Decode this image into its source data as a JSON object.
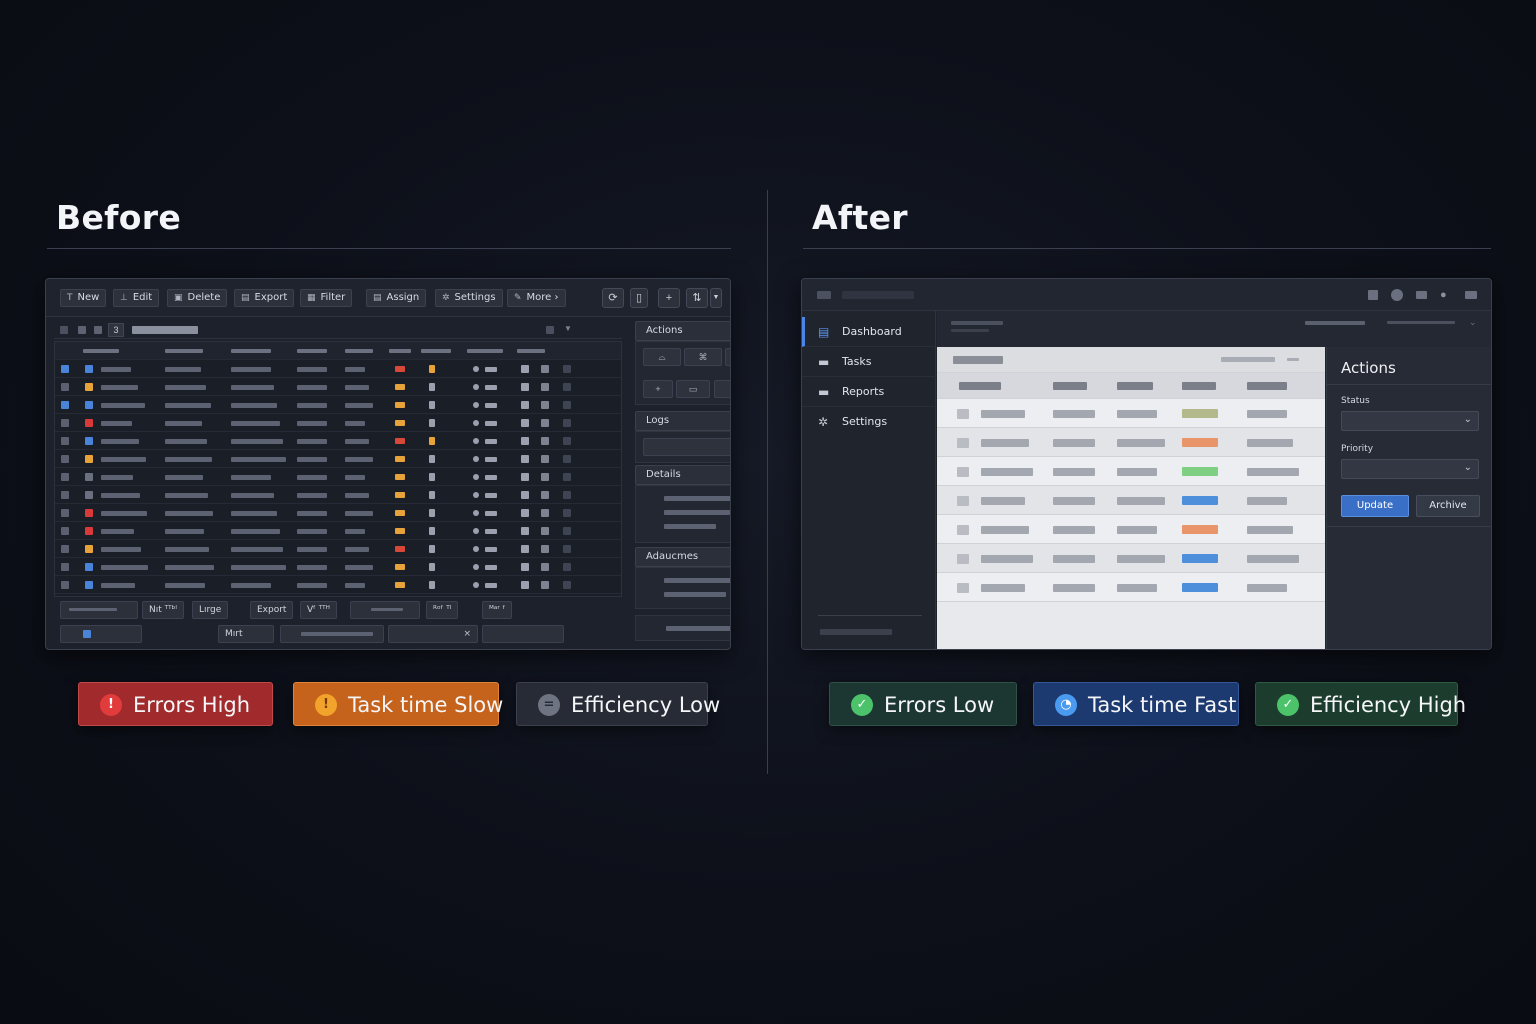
{
  "before": {
    "heading": "Before",
    "toolbar": {
      "buttons": [
        {
          "icon": "T",
          "label": "New"
        },
        {
          "icon": "⊥",
          "label": "Edit"
        },
        {
          "icon": "▣",
          "label": "Delete"
        },
        {
          "icon": "▤",
          "label": "Export"
        },
        {
          "icon": "▦",
          "label": "Filter"
        },
        {
          "icon": "▤",
          "label": "Assign"
        },
        {
          "icon": "✲",
          "label": "Settings"
        },
        {
          "icon": "✎",
          "label": "More ›"
        }
      ],
      "grid_count": "3"
    },
    "side_panels": {
      "actions": "Actions",
      "logs": "Logs",
      "details": "Details",
      "attachments": "Adaucmes"
    },
    "footer": {
      "row1": [
        "Nıt ᵀᵀᵇˡ",
        "Lırge",
        "Export",
        "ᐯᶠ ᵀᵀᴴ",
        "ᴿᵒᶠ ᵀᴵ",
        "ᴹᵃʳ ᶠ"
      ],
      "row2": [
        "Mırt"
      ]
    },
    "badges": [
      {
        "icon": "!",
        "label": "Errors High",
        "color": "#a52a2a"
      },
      {
        "icon": "!",
        "label": "Task time Slow",
        "color": "#c8641d"
      },
      {
        "icon": "=",
        "label": "Efficiency Low",
        "color": "#2a2f3b"
      }
    ]
  },
  "after": {
    "heading": "After",
    "nav": [
      {
        "icon": "dashboard-icon",
        "label": "Dashboard",
        "active": true
      },
      {
        "icon": "tasks-icon",
        "label": "Tasks",
        "active": false
      },
      {
        "icon": "reports-icon",
        "label": "Reports",
        "active": false
      },
      {
        "icon": "settings-icon",
        "label": "Settings",
        "active": false
      }
    ],
    "actions": {
      "title": "Actions",
      "status_label": "Status",
      "priority_label": "Priority",
      "update_label": "Update",
      "archive_label": "Archive"
    },
    "status_colors": [
      "#b3b98a",
      "#e8956a",
      "#7fcf82",
      "#4e8fdc",
      "#e8956a",
      "#4e8fdc",
      "#4e8fdc"
    ],
    "badges": [
      {
        "icon": "✓",
        "label": "Errors Low",
        "color": "#1e3a34"
      },
      {
        "icon": "◔",
        "label": "Task time Fast",
        "color": "#1e3c73"
      },
      {
        "icon": "✓",
        "label": "Efficiency High",
        "color": "#1e4233"
      }
    ]
  }
}
